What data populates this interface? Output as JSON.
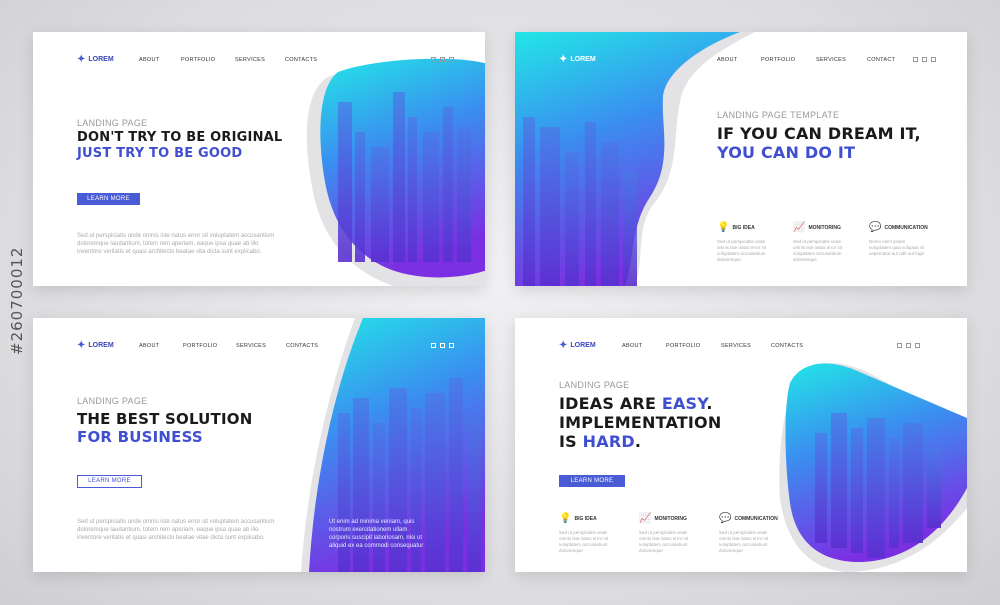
{
  "stock_id": "#260700012",
  "colors": {
    "brand_blue": "#4a5bd6",
    "cyan": "#21e4e4",
    "violet": "#7a2fe0"
  },
  "card1": {
    "logo": "LOREM",
    "nav": [
      "ABOUT",
      "PORTFOLIO",
      "SERVICES",
      "CONTACTS"
    ],
    "eyebrow": "LANDING PAGE",
    "headline_1": "DON'T TRY TO BE ORIGINAL",
    "headline_2": "JUST TRY TO BE GOOD",
    "button": "LEARN MORE",
    "paragraph": "Sed ut perspiciatis unde omnis iste natus error sit voluptatem accusantium doloremque laudantium, totem rem aperiam, eaque ipsa quae ab illo inventore veritatis et quasi architecto beatae vita dicta sunt explicabo."
  },
  "card2": {
    "logo": "LOREM",
    "nav": [
      "ABOUT",
      "PORTFOLIO",
      "SERVICES",
      "CONTACT"
    ],
    "eyebrow": "LANDING PAGE TEMPLATE",
    "headline_1": "IF YOU CAN DREAM IT,",
    "headline_2": "YOU CAN DO IT",
    "features": [
      {
        "icon": "lightbulb-icon",
        "glyph": "💡",
        "title": "BIG IDEA",
        "desc": "Sed ut perspiciatis unde omnis iste natus error sit voluptatem accusantium doloremque"
      },
      {
        "icon": "chart-icon",
        "glyph": "📈",
        "title": "MONITORING",
        "desc": "Sed ut perspiciatis unde omnis iste natus error sit voluptatem accusantium doloremque"
      },
      {
        "icon": "communication-icon",
        "glyph": "💬",
        "title": "COMMUNICATION",
        "desc": "Nemo enim ipsam voluptatem quia voluptas sit aspernatur aut odit aut fugit"
      }
    ]
  },
  "card3": {
    "logo": "LOREM",
    "nav": [
      "ABOUT",
      "PORTFOLIO",
      "SERVICES",
      "CONTACTS"
    ],
    "eyebrow": "LANDING PAGE",
    "headline_1": "THE BEST SOLUTION",
    "headline_2": "FOR BUSINESS",
    "button": "LEARN MORE",
    "paragraph": "Sed ut perspiciatis unde omnis iste natus error sit voluptatem accusantium doloremque laudantium, totem rem aperiam, eaque ipsa quae ab illo inventore veritatis et quasi architecto beatae vitae dicta sunt explicabo.",
    "overlay_text": "Ut enim ad minima veniam, quis nostrum exercitationem ullam corporis suscipit laboriosam, nisi ut aliquid ex ea commodi consequatur"
  },
  "card4": {
    "logo": "LOREM",
    "nav": [
      "ABOUT",
      "PORTFOLIO",
      "SERVICES",
      "CONTACTS"
    ],
    "eyebrow": "LANDING PAGE",
    "line1_a": "IDEAS ARE ",
    "line1_b": "EASY",
    "line1_c": ".",
    "line2": "IMPLEMENTATION",
    "line3_a": "IS ",
    "line3_b": "HARD",
    "line3_c": ".",
    "button": "LEARN MORE",
    "features": [
      {
        "icon": "lightbulb-icon",
        "glyph": "💡",
        "title": "BIG IDEA",
        "desc": "Sed ut perspiciatis unde omnis iste natus error sit voluptatem accusantium doloremque"
      },
      {
        "icon": "chart-icon",
        "glyph": "📈",
        "title": "MONITORING",
        "desc": "Sed ut perspiciatis unde omnis iste natus error sit voluptatem accusantium doloremque"
      },
      {
        "icon": "communication-icon",
        "glyph": "💬",
        "title": "COMMUNICATION",
        "desc": "Sed ut perspiciatis unde omnis iste natus error sit voluptatem accusantium doloremque"
      }
    ]
  }
}
